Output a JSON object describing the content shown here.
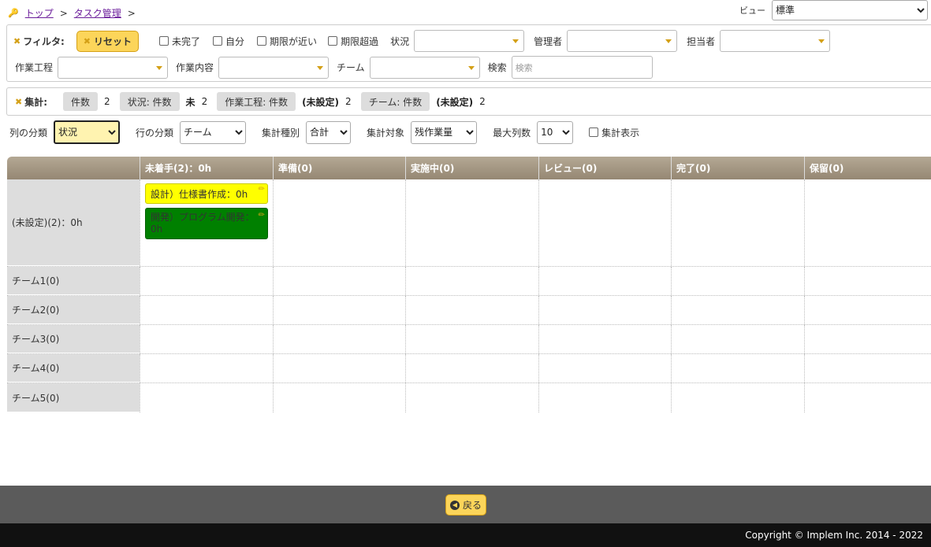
{
  "breadcrumb": {
    "top": "トップ",
    "task": "タスク管理",
    "sep": ">"
  },
  "view": {
    "label": "ビュー",
    "value": "標準"
  },
  "filter": {
    "title": "フィルタ:",
    "reset": "リセット",
    "incomplete": "未完了",
    "self": "自分",
    "near_due": "期限が近い",
    "overdue": "期限超過",
    "status_label": "状況",
    "manager_label": "管理者",
    "owner_label": "担当者",
    "process_label": "作業工程",
    "content_label": "作業内容",
    "team_label": "チーム",
    "search_label": "検索",
    "search_placeholder": "検索"
  },
  "aggregate": {
    "title": "集計:",
    "items": [
      {
        "tag": "件数",
        "val": "",
        "num": "2"
      },
      {
        "tag": "状況: 件数",
        "val": "未",
        "num": "2"
      },
      {
        "tag": "作業工程: 件数",
        "val": "(未設定)",
        "num": "2"
      },
      {
        "tag": "チーム: 件数",
        "val": "(未設定)",
        "num": "2"
      }
    ]
  },
  "options": {
    "col_class_label": "列の分類",
    "col_class": "状況",
    "row_class_label": "行の分類",
    "row_class": "チーム",
    "agg_type_label": "集計種別",
    "agg_type": "合計",
    "agg_target_label": "集計対象",
    "agg_target": "残作業量",
    "max_cols_label": "最大列数",
    "max_cols": "10",
    "show_agg": "集計表示"
  },
  "kanban": {
    "columns": [
      "未着手(2)：0h",
      "準備(0)",
      "実施中(0)",
      "レビュー(0)",
      "完了(0)",
      "保留(0)"
    ],
    "rows": [
      "(未設定)(2)：0h",
      "チーム1(0)",
      "チーム2(0)",
      "チーム3(0)",
      "チーム4(0)",
      "チーム5(0)"
    ],
    "cards": [
      {
        "text": "設計）仕様書作成：0h",
        "color": "#ffff00"
      },
      {
        "text": "開発）プログラム開発：0h",
        "color": "#008000"
      }
    ]
  },
  "footer": {
    "back": "戻る",
    "copyright": "Copyright © Implem Inc. 2014 - 2022"
  }
}
